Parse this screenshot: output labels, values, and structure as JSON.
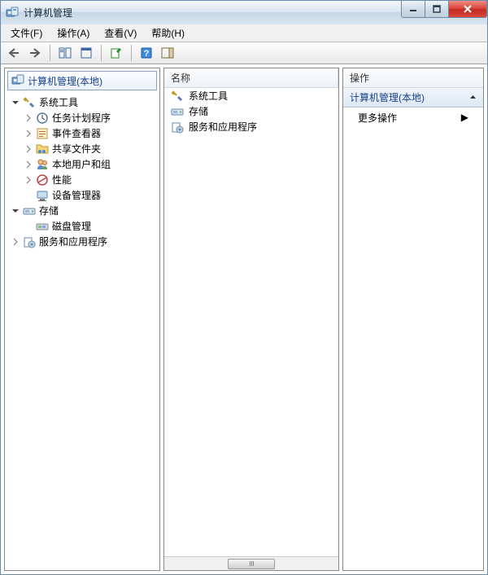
{
  "window": {
    "title": "计算机管理"
  },
  "menubar": {
    "file": "文件(F)",
    "action": "操作(A)",
    "view": "查看(V)",
    "help": "帮助(H)"
  },
  "tree": {
    "root": "计算机管理(本地)",
    "system_tools": "系统工具",
    "task_scheduler": "任务计划程序",
    "event_viewer": "事件查看器",
    "shared_folders": "共享文件夹",
    "local_users": "本地用户和组",
    "performance": "性能",
    "device_manager": "设备管理器",
    "storage": "存储",
    "disk_management": "磁盘管理",
    "services": "服务和应用程序"
  },
  "list": {
    "header_name": "名称",
    "rows": {
      "system_tools": "系统工具",
      "storage": "存储",
      "services": "服务和应用程序"
    }
  },
  "actions": {
    "header": "操作",
    "section": "计算机管理(本地)",
    "more_actions": "更多操作"
  }
}
